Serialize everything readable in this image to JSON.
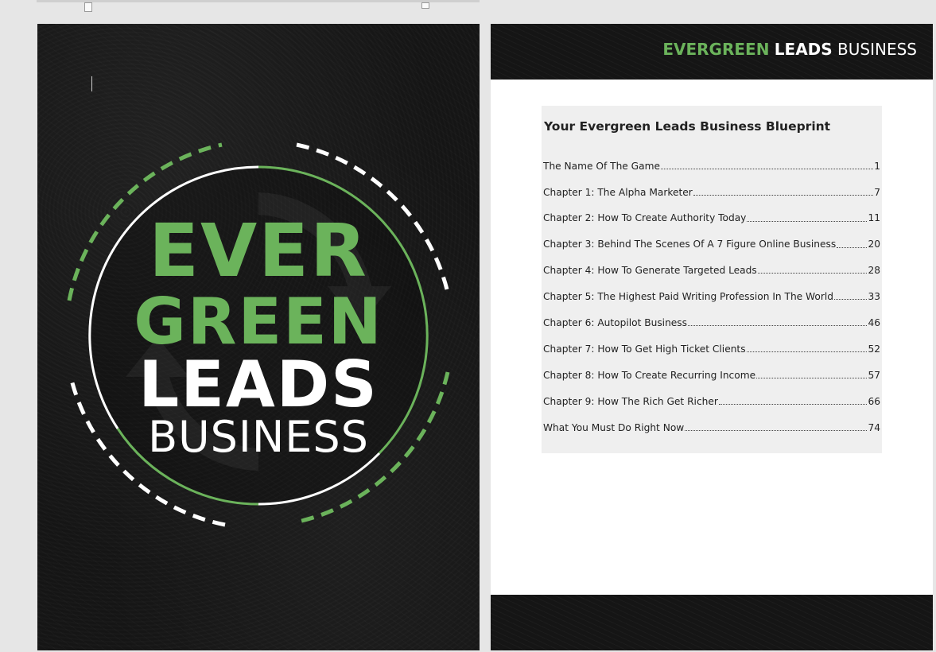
{
  "cover": {
    "title_lines": [
      "EVER",
      "GREEN",
      "LEADS",
      "BUSINESS"
    ],
    "colors": {
      "accent": "#6bb35b",
      "text": "#ffffff",
      "background": "#141414"
    }
  },
  "toc_page": {
    "header_brand": {
      "part1": "EVERGREEN",
      "part2": "LEADS",
      "part3": "BUSINESS"
    },
    "title": "Your Evergreen Leads Business Blueprint",
    "entries": [
      {
        "label": "The Name Of The Game",
        "page": "1"
      },
      {
        "label": "Chapter 1: The Alpha Marketer",
        "page": "7"
      },
      {
        "label": "Chapter 2: How To Create Authority Today",
        "page": "11"
      },
      {
        "label": "Chapter 3: Behind The Scenes Of A 7 Figure Online Business",
        "page": "20"
      },
      {
        "label": "Chapter 4: How To Generate Targeted Leads",
        "page": "28"
      },
      {
        "label": "Chapter 5: The Highest Paid Writing Profession In The World",
        "page": "33"
      },
      {
        "label": "Chapter 6: Autopilot Business",
        "page": "46"
      },
      {
        "label": "Chapter 7: How To Get High Ticket Clients",
        "page": "52"
      },
      {
        "label": "Chapter 8: How To Create Recurring Income",
        "page": "57"
      },
      {
        "label": "Chapter 9: How The Rich Get Richer",
        "page": "66"
      },
      {
        "label": "What You Must Do Right Now",
        "page": "74"
      }
    ]
  }
}
